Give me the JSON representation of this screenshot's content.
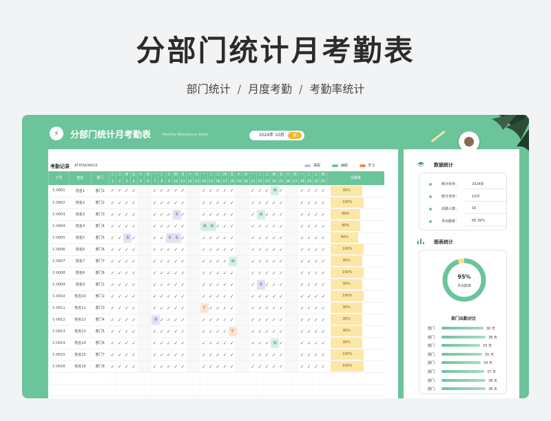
{
  "page": {
    "title": "分部门统计月考勤表",
    "subtitle_items": [
      "部门统计",
      "月度考勤",
      "考勤率统计"
    ],
    "subtitle_sep": "/"
  },
  "sheet": {
    "title": "分部门统计月考勤表",
    "title_en": "Monthly Attendance Sheet",
    "date_value": "2024年 10月",
    "date_button": "编",
    "logo_icon": "chart-line-icon"
  },
  "record": {
    "title": "考勤记录",
    "title_en": "ATTENDANCE",
    "legend": [
      {
        "label": "事假",
        "color": "#b9c3ea"
      },
      {
        "label": "病假",
        "color": "#6bc49a"
      },
      {
        "label": "旷工",
        "color": "#ee8a4a"
      }
    ],
    "col_headers": {
      "id": "工号",
      "name": "姓名",
      "dept": "部门",
      "rate": "出勤率"
    },
    "weekdays": [
      "二",
      "三",
      "四",
      "五",
      "六",
      "日",
      "一",
      "二",
      "三",
      "四",
      "五",
      "六",
      "日",
      "一",
      "二",
      "三",
      "四",
      "五",
      "六",
      "日",
      "一",
      "二",
      "三",
      "四",
      "五",
      "六",
      "日",
      "一",
      "二",
      "三",
      "四"
    ],
    "days": [
      "1",
      "2",
      "3",
      "4",
      "5",
      "6",
      "7",
      "8",
      "9",
      "10",
      "11",
      "12",
      "13",
      "14",
      "15",
      "16",
      "17",
      "18",
      "19",
      "20",
      "21",
      "22",
      "23",
      "24",
      "25",
      "26",
      "27",
      "28",
      "29",
      "30",
      "31"
    ],
    "check": "✓",
    "rows": [
      {
        "id": "C-0001",
        "name": "姓名1",
        "dept": "部门1",
        "rate": "95%",
        "rate_value": 95,
        "special": [
          {
            "day": 24,
            "type": "病"
          }
        ]
      },
      {
        "id": "C-0002",
        "name": "姓名2",
        "dept": "部门2",
        "rate": "100%",
        "rate_value": 100,
        "special": []
      },
      {
        "id": "C-0003",
        "name": "姓名3",
        "dept": "部门3",
        "rate": "89%",
        "rate_value": 89,
        "special": [
          {
            "day": 10,
            "type": "事"
          },
          {
            "day": 22,
            "type": "病"
          }
        ]
      },
      {
        "id": "C-0004",
        "name": "姓名4",
        "dept": "部门4",
        "rate": "89%",
        "rate_value": 89,
        "special": [
          {
            "day": 14,
            "type": "病"
          },
          {
            "day": 15,
            "type": "病"
          }
        ]
      },
      {
        "id": "C-0005",
        "name": "姓名5",
        "dept": "部门5",
        "rate": "84%",
        "rate_value": 84,
        "special": [
          {
            "day": 3,
            "type": "事"
          },
          {
            "day": 9,
            "type": "事"
          },
          {
            "day": 10,
            "type": "事"
          }
        ]
      },
      {
        "id": "C-0006",
        "name": "姓名6",
        "dept": "部门6",
        "rate": "100%",
        "rate_value": 100,
        "special": []
      },
      {
        "id": "C-0007",
        "name": "姓名7",
        "dept": "部门7",
        "rate": "95%",
        "rate_value": 95,
        "special": [
          {
            "day": 18,
            "type": "病"
          }
        ]
      },
      {
        "id": "C-0008",
        "name": "姓名8",
        "dept": "部门8",
        "rate": "100%",
        "rate_value": 100,
        "special": []
      },
      {
        "id": "C-0009",
        "name": "姓名9",
        "dept": "部门1",
        "rate": "95%",
        "rate_value": 95,
        "special": [
          {
            "day": 22,
            "type": "事"
          }
        ]
      },
      {
        "id": "C-0010",
        "name": "姓名10",
        "dept": "部门2",
        "rate": "100%",
        "rate_value": 100,
        "special": []
      },
      {
        "id": "C-0011",
        "name": "姓名11",
        "dept": "部门3",
        "rate": "95%",
        "rate_value": 95,
        "special": [
          {
            "day": 14,
            "type": "旷"
          }
        ]
      },
      {
        "id": "C-0012",
        "name": "姓名12",
        "dept": "部门4",
        "rate": "95%",
        "rate_value": 95,
        "special": [
          {
            "day": 7,
            "type": "事"
          }
        ]
      },
      {
        "id": "C-0013",
        "name": "姓名13",
        "dept": "部门5",
        "rate": "95%",
        "rate_value": 95,
        "special": [
          {
            "day": 18,
            "type": "旷"
          }
        ]
      },
      {
        "id": "C-0014",
        "name": "姓名14",
        "dept": "部门6",
        "rate": "95%",
        "rate_value": 95,
        "special": [
          {
            "day": 24,
            "type": "病"
          }
        ]
      },
      {
        "id": "C-0015",
        "name": "姓名15",
        "dept": "部门7",
        "rate": "100%",
        "rate_value": 100,
        "special": []
      },
      {
        "id": "C-0016",
        "name": "姓名16",
        "dept": "部门8",
        "rate": "100%",
        "rate_value": 100,
        "special": []
      }
    ]
  },
  "stats": {
    "title": "数据统计",
    "items": [
      {
        "label": "统计年份：",
        "value": "2024年"
      },
      {
        "label": "统计月份：",
        "value": "10月"
      },
      {
        "label": "出勤人数：",
        "value": "16"
      },
      {
        "label": "月出勤率：",
        "value": "95.39%"
      }
    ]
  },
  "chart": {
    "title": "图表统计",
    "chart_data": [
      {
        "type": "pie",
        "title": "",
        "value_label": "95%",
        "label": "月出勤率",
        "values": [
          95,
          5
        ],
        "colors": [
          "#6bc49a",
          "#fbe08c"
        ]
      },
      {
        "type": "bar",
        "title": "部门出勤对比",
        "categories": [
          "部门",
          "部门",
          "部门",
          "部门",
          "部门",
          "部门",
          "部门",
          "部门"
        ],
        "values": [
          36,
          38,
          33,
          35,
          34,
          37,
          38,
          38
        ],
        "value_labels": [
          "36 天",
          "38 天",
          "33 天",
          "35 天",
          "34 天",
          "37 天",
          "38 天",
          "38 天"
        ],
        "xlim": [
          0,
          45
        ]
      }
    ]
  },
  "colors": {
    "accent": "#6bc49a",
    "rate_fill": "#fde7a7"
  }
}
